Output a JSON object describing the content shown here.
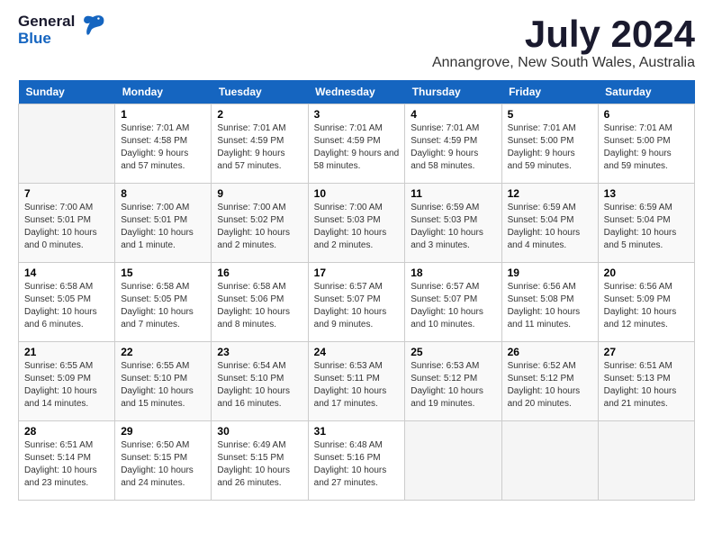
{
  "header": {
    "logo_line1": "General",
    "logo_line2": "Blue",
    "month": "July 2024",
    "location": "Annangrove, New South Wales, Australia"
  },
  "days_of_week": [
    "Sunday",
    "Monday",
    "Tuesday",
    "Wednesday",
    "Thursday",
    "Friday",
    "Saturday"
  ],
  "weeks": [
    [
      {
        "day": "",
        "sunrise": "",
        "sunset": "",
        "daylight": ""
      },
      {
        "day": "1",
        "sunrise": "Sunrise: 7:01 AM",
        "sunset": "Sunset: 4:58 PM",
        "daylight": "Daylight: 9 hours and 57 minutes."
      },
      {
        "day": "2",
        "sunrise": "Sunrise: 7:01 AM",
        "sunset": "Sunset: 4:59 PM",
        "daylight": "Daylight: 9 hours and 57 minutes."
      },
      {
        "day": "3",
        "sunrise": "Sunrise: 7:01 AM",
        "sunset": "Sunset: 4:59 PM",
        "daylight": "Daylight: 9 hours and 58 minutes."
      },
      {
        "day": "4",
        "sunrise": "Sunrise: 7:01 AM",
        "sunset": "Sunset: 4:59 PM",
        "daylight": "Daylight: 9 hours and 58 minutes."
      },
      {
        "day": "5",
        "sunrise": "Sunrise: 7:01 AM",
        "sunset": "Sunset: 5:00 PM",
        "daylight": "Daylight: 9 hours and 59 minutes."
      },
      {
        "day": "6",
        "sunrise": "Sunrise: 7:01 AM",
        "sunset": "Sunset: 5:00 PM",
        "daylight": "Daylight: 9 hours and 59 minutes."
      }
    ],
    [
      {
        "day": "7",
        "sunrise": "Sunrise: 7:00 AM",
        "sunset": "Sunset: 5:01 PM",
        "daylight": "Daylight: 10 hours and 0 minutes."
      },
      {
        "day": "8",
        "sunrise": "Sunrise: 7:00 AM",
        "sunset": "Sunset: 5:01 PM",
        "daylight": "Daylight: 10 hours and 1 minute."
      },
      {
        "day": "9",
        "sunrise": "Sunrise: 7:00 AM",
        "sunset": "Sunset: 5:02 PM",
        "daylight": "Daylight: 10 hours and 2 minutes."
      },
      {
        "day": "10",
        "sunrise": "Sunrise: 7:00 AM",
        "sunset": "Sunset: 5:03 PM",
        "daylight": "Daylight: 10 hours and 2 minutes."
      },
      {
        "day": "11",
        "sunrise": "Sunrise: 6:59 AM",
        "sunset": "Sunset: 5:03 PM",
        "daylight": "Daylight: 10 hours and 3 minutes."
      },
      {
        "day": "12",
        "sunrise": "Sunrise: 6:59 AM",
        "sunset": "Sunset: 5:04 PM",
        "daylight": "Daylight: 10 hours and 4 minutes."
      },
      {
        "day": "13",
        "sunrise": "Sunrise: 6:59 AM",
        "sunset": "Sunset: 5:04 PM",
        "daylight": "Daylight: 10 hours and 5 minutes."
      }
    ],
    [
      {
        "day": "14",
        "sunrise": "Sunrise: 6:58 AM",
        "sunset": "Sunset: 5:05 PM",
        "daylight": "Daylight: 10 hours and 6 minutes."
      },
      {
        "day": "15",
        "sunrise": "Sunrise: 6:58 AM",
        "sunset": "Sunset: 5:05 PM",
        "daylight": "Daylight: 10 hours and 7 minutes."
      },
      {
        "day": "16",
        "sunrise": "Sunrise: 6:58 AM",
        "sunset": "Sunset: 5:06 PM",
        "daylight": "Daylight: 10 hours and 8 minutes."
      },
      {
        "day": "17",
        "sunrise": "Sunrise: 6:57 AM",
        "sunset": "Sunset: 5:07 PM",
        "daylight": "Daylight: 10 hours and 9 minutes."
      },
      {
        "day": "18",
        "sunrise": "Sunrise: 6:57 AM",
        "sunset": "Sunset: 5:07 PM",
        "daylight": "Daylight: 10 hours and 10 minutes."
      },
      {
        "day": "19",
        "sunrise": "Sunrise: 6:56 AM",
        "sunset": "Sunset: 5:08 PM",
        "daylight": "Daylight: 10 hours and 11 minutes."
      },
      {
        "day": "20",
        "sunrise": "Sunrise: 6:56 AM",
        "sunset": "Sunset: 5:09 PM",
        "daylight": "Daylight: 10 hours and 12 minutes."
      }
    ],
    [
      {
        "day": "21",
        "sunrise": "Sunrise: 6:55 AM",
        "sunset": "Sunset: 5:09 PM",
        "daylight": "Daylight: 10 hours and 14 minutes."
      },
      {
        "day": "22",
        "sunrise": "Sunrise: 6:55 AM",
        "sunset": "Sunset: 5:10 PM",
        "daylight": "Daylight: 10 hours and 15 minutes."
      },
      {
        "day": "23",
        "sunrise": "Sunrise: 6:54 AM",
        "sunset": "Sunset: 5:10 PM",
        "daylight": "Daylight: 10 hours and 16 minutes."
      },
      {
        "day": "24",
        "sunrise": "Sunrise: 6:53 AM",
        "sunset": "Sunset: 5:11 PM",
        "daylight": "Daylight: 10 hours and 17 minutes."
      },
      {
        "day": "25",
        "sunrise": "Sunrise: 6:53 AM",
        "sunset": "Sunset: 5:12 PM",
        "daylight": "Daylight: 10 hours and 19 minutes."
      },
      {
        "day": "26",
        "sunrise": "Sunrise: 6:52 AM",
        "sunset": "Sunset: 5:12 PM",
        "daylight": "Daylight: 10 hours and 20 minutes."
      },
      {
        "day": "27",
        "sunrise": "Sunrise: 6:51 AM",
        "sunset": "Sunset: 5:13 PM",
        "daylight": "Daylight: 10 hours and 21 minutes."
      }
    ],
    [
      {
        "day": "28",
        "sunrise": "Sunrise: 6:51 AM",
        "sunset": "Sunset: 5:14 PM",
        "daylight": "Daylight: 10 hours and 23 minutes."
      },
      {
        "day": "29",
        "sunrise": "Sunrise: 6:50 AM",
        "sunset": "Sunset: 5:15 PM",
        "daylight": "Daylight: 10 hours and 24 minutes."
      },
      {
        "day": "30",
        "sunrise": "Sunrise: 6:49 AM",
        "sunset": "Sunset: 5:15 PM",
        "daylight": "Daylight: 10 hours and 26 minutes."
      },
      {
        "day": "31",
        "sunrise": "Sunrise: 6:48 AM",
        "sunset": "Sunset: 5:16 PM",
        "daylight": "Daylight: 10 hours and 27 minutes."
      },
      {
        "day": "",
        "sunrise": "",
        "sunset": "",
        "daylight": ""
      },
      {
        "day": "",
        "sunrise": "",
        "sunset": "",
        "daylight": ""
      },
      {
        "day": "",
        "sunrise": "",
        "sunset": "",
        "daylight": ""
      }
    ]
  ]
}
